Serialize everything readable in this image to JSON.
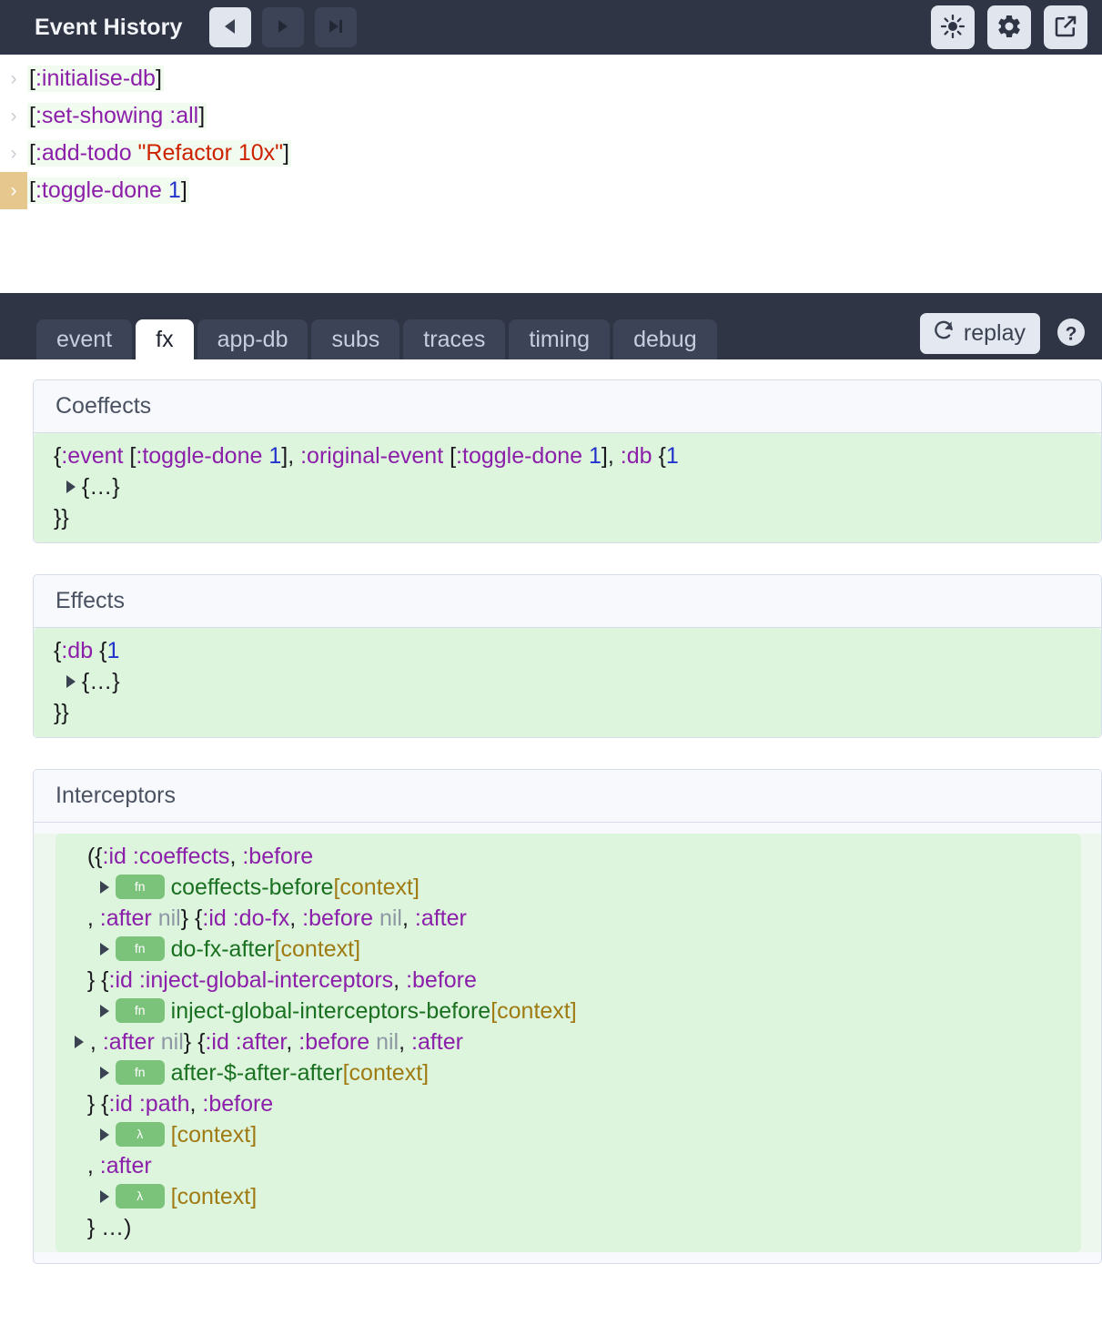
{
  "header": {
    "title": "Event History",
    "nav": [
      {
        "name": "step-back",
        "icon": "triangle-left-icon",
        "active": true
      },
      {
        "name": "step-forward",
        "icon": "triangle-right-icon",
        "active": false
      },
      {
        "name": "skip-to-end",
        "icon": "skip-to-end-icon",
        "active": false
      }
    ],
    "actions": [
      {
        "name": "brightness-toggle",
        "icon": "sun-icon"
      },
      {
        "name": "settings",
        "icon": "gear-icon"
      },
      {
        "name": "popout",
        "icon": "external-link-icon"
      }
    ]
  },
  "events": [
    {
      "selected": false,
      "text": "[:initialise-db]"
    },
    {
      "selected": false,
      "text": "[:set-showing :all]"
    },
    {
      "selected": false,
      "text": "[:add-todo \"Refactor 10x\"]"
    },
    {
      "selected": true,
      "text": "[:toggle-done 1]"
    }
  ],
  "tabs": [
    {
      "label": "event",
      "active": false
    },
    {
      "label": "fx",
      "active": true
    },
    {
      "label": "app-db",
      "active": false
    },
    {
      "label": "subs",
      "active": false
    },
    {
      "label": "traces",
      "active": false
    },
    {
      "label": "timing",
      "active": false
    },
    {
      "label": "debug",
      "active": false
    }
  ],
  "toolbar": {
    "replay_label": "replay",
    "replay_icon": "refresh-icon",
    "help_icon": "question-mark-icon"
  },
  "panels": {
    "coeffects": {
      "title": "Coeffects",
      "lines": [
        "{:event [:toggle-done 1], :original-event [:toggle-done 1], :db {1",
        "  ▸ {…}",
        "}}"
      ]
    },
    "effects": {
      "title": "Effects",
      "lines": [
        "{:db {1",
        "  ▸ {…}",
        "}}"
      ]
    },
    "interceptors": {
      "title": "Interceptors",
      "lines": [
        "({:id :coeffects, :before",
        "  ▸ fn coeffects-before [context]",
        ", :after nil} {:id :do-fx, :before nil, :after",
        "  ▸ fn do-fx-after [context]",
        "} {:id :inject-global-interceptors, :before",
        "  ▸ fn inject-global-interceptors-before [context]",
        "▸ , :after nil} {:id :after, :before nil, :after",
        "  ▸ fn after-$-after-after [context]",
        "} {:id :path, :before",
        "  ▸ λ [context]",
        ", :after",
        "  ▸ λ [context]",
        "} …)"
      ],
      "badges": {
        "fn": "fn",
        "lambda": "λ"
      },
      "context_label": "[context]",
      "fn_names": [
        "coeffects-before",
        "do-fx-after",
        "inject-global-interceptors-before",
        "after-$-after-after"
      ]
    }
  },
  "colors": {
    "header_bg": "#2f3545",
    "tab_bg": "#3c4356",
    "selected_marker": "#e6c88e",
    "code_bg": "#ddf5dd",
    "keyword": "#8b1fa9",
    "string": "#cc2200",
    "number": "#2233cc",
    "fn_name": "#197020",
    "context": "#a07a13",
    "badge": "#7bc27b"
  }
}
